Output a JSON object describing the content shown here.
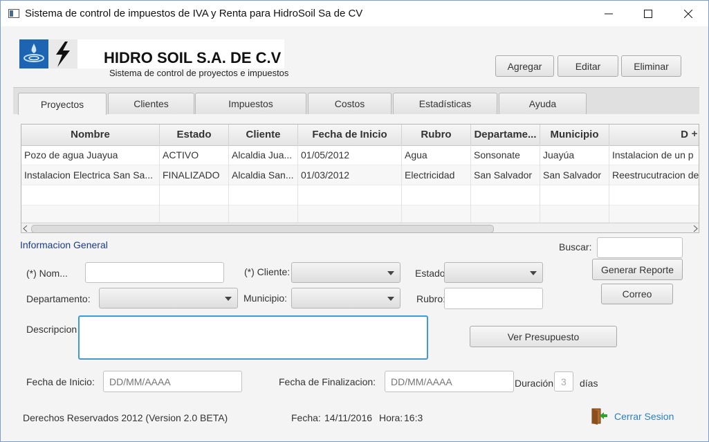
{
  "window": {
    "title": "Sistema de control de impuestos de IVA y Renta para HidroSoil Sa de CV",
    "controls": {
      "minimize": "—",
      "maximize": "☐",
      "close": "✕"
    }
  },
  "header": {
    "company": "HIDRO SOIL S.A. DE C.V",
    "subtitle": "Sistema de control de proyectos e impuestos",
    "buttons": {
      "add": "Agregar",
      "edit": "Editar",
      "delete": "Eliminar"
    }
  },
  "tabs": [
    "Proyectos",
    "Clientes",
    "Impuestos",
    "Costos",
    "Estadísticas",
    "Ayuda"
  ],
  "table": {
    "columns": [
      "Nombre",
      "Estado",
      "Cliente",
      "Fecha de Inicio",
      "Rubro",
      "Departame...",
      "Municipio",
      "D"
    ],
    "rows": [
      [
        "Pozo de agua Juayua",
        "ACTIVO",
        "Alcaldia Jua...",
        "01/05/2012",
        "Agua",
        "Sonsonate",
        "Juayúa",
        "Instalacion de un p"
      ],
      [
        "Instalacion Electrica San Sa...",
        "FINALIZADO",
        "Alcaldia San...",
        "01/03/2012",
        "Electricidad",
        "San Salvador",
        "San Salvador",
        "Reestrucutracion de"
      ]
    ],
    "column_menu_glyph": "+"
  },
  "form": {
    "section_title": "Informacion General",
    "search_label": "Buscar:",
    "search_value": "",
    "name_label": "(*) Nom...",
    "name_value": "",
    "client_label": "(*) Cliente:",
    "state_label": "Estado",
    "department_label": "Departamento:",
    "municipality_label": "Municipio:",
    "rubro_label": "Rubro:",
    "rubro_value": "",
    "description_label": "Descripcion",
    "description_value": "",
    "start_label": "Fecha de  Inicio:",
    "start_placeholder": "DD/MM/AAAA",
    "end_label": "Fecha de  Finalizacion:",
    "end_placeholder": "DD/MM/AAAA",
    "duration_label": "Duración",
    "duration_value": "3",
    "days_label": "días",
    "generate_report": "Generar Reporte",
    "mail": "Correo",
    "view_budget": "Ver Presupuesto"
  },
  "footer": {
    "rights": "Derechos Reservados 2012 (Version 2.0 BETA)",
    "date_label": "Fecha:",
    "date_value": "14/11/2016",
    "time_label": "Hora:",
    "time_value": "16:3",
    "logout": "Cerrar Sesion"
  },
  "colors": {
    "section_title": "#1a3a8a",
    "logout_link": "#2a7fc4",
    "focus_border": "#3d9ad8"
  }
}
